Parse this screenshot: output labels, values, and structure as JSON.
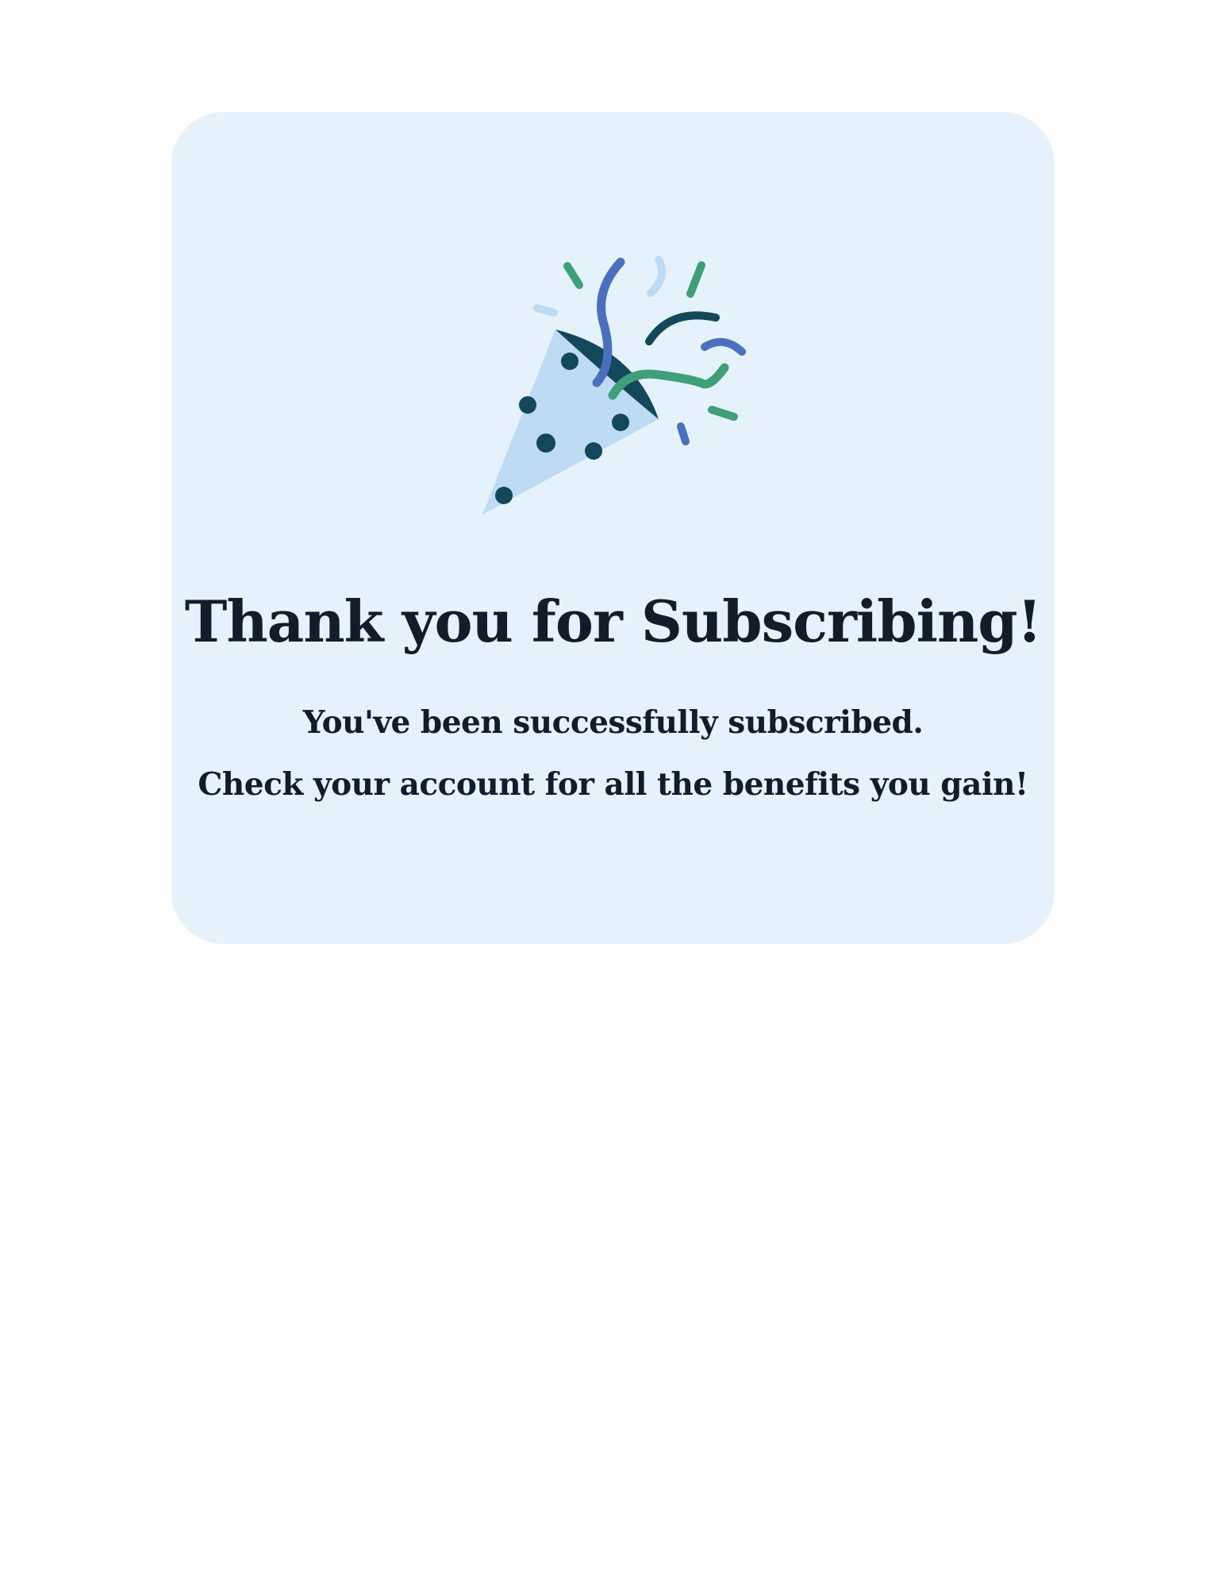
{
  "confirmation": {
    "icon": "party-popper-icon",
    "title": "Thank you for Subscribing!",
    "message_line_1": "You've been successfully subscribed.",
    "message_line_2": "Check your account for all the benefits you gain!"
  },
  "colors": {
    "page_background": "#fefefe",
    "card_background": "#e5f2fb",
    "text": "#131c2a",
    "cone_light": "#bddbf3",
    "cone_dark": "#12485a",
    "confetti_blue": "#4a70bd",
    "confetti_green": "#3f9f78"
  }
}
